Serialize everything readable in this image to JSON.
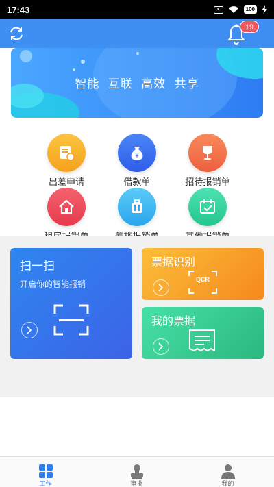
{
  "status_bar": {
    "time": "17:43",
    "sim_label": "✕",
    "battery": "100"
  },
  "header": {
    "refresh_icon": "refresh-icon",
    "bell_icon": "bell-icon",
    "notification_count": "19"
  },
  "banner": {
    "tagline": "智能 互联 高效 共享"
  },
  "grid": {
    "items": [
      {
        "label": "出差申请",
        "icon": "document-icon",
        "color": "#f7b529"
      },
      {
        "label": "借款单",
        "icon": "money-bag-icon",
        "color": "#3a6ff0"
      },
      {
        "label": "招待报销单",
        "icon": "wine-glass-icon",
        "color": "#f4734d"
      },
      {
        "label": "租房报销单",
        "icon": "house-icon",
        "color": "#ee4c5b"
      },
      {
        "label": "差旅报销单",
        "icon": "suitcase-icon",
        "color": "#39b6f3"
      },
      {
        "label": "其他报销单",
        "icon": "calendar-check-icon",
        "color": "#3ad8a0"
      }
    ]
  },
  "cards": {
    "scan": {
      "title": "扫一扫",
      "subtitle": "开启你的智能报销"
    },
    "ocr": {
      "title": "票据识别",
      "ocr_text": "QCR"
    },
    "my_bills": {
      "title": "我的票据"
    }
  },
  "bottom_nav": {
    "items": [
      {
        "label": "工作",
        "active": true
      },
      {
        "label": "审批",
        "active": false
      },
      {
        "label": "我的",
        "active": false
      }
    ]
  },
  "colors": {
    "header": "#3f8ff2",
    "accent": "#2f7fef",
    "badge": "#f0595f"
  }
}
